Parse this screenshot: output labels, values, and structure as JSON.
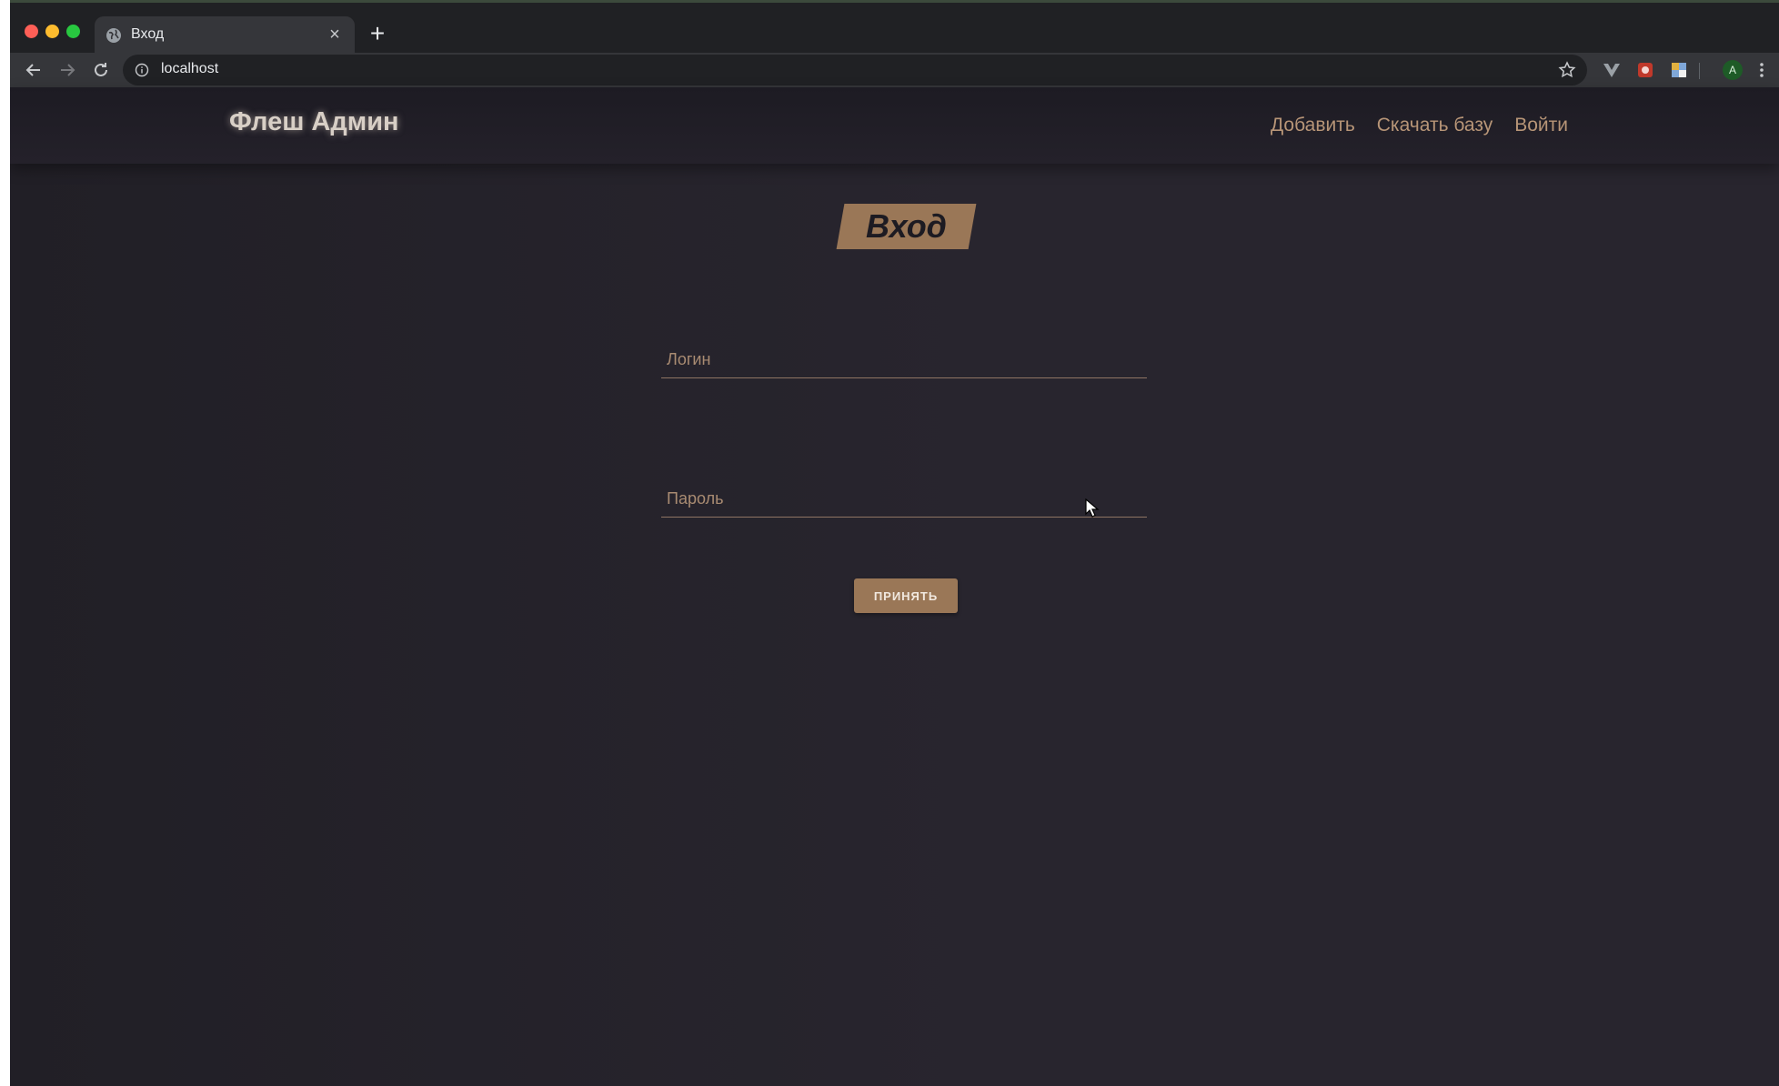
{
  "browser": {
    "tab": {
      "title": "Вход",
      "close_glyph": "×"
    },
    "new_tab_glyph": "+",
    "address_bar": {
      "url": "localhost"
    },
    "profile_initial": "A",
    "icons": [
      "back-icon",
      "forward-icon",
      "reload-icon",
      "info-icon",
      "star-icon",
      "vue-devtools-icon",
      "extension-icon",
      "extension-grid-icon",
      "kebab-menu-icon",
      "globe-icon"
    ]
  },
  "navbar": {
    "brand": "Флеш Админ",
    "links": [
      {
        "label": "Добавить"
      },
      {
        "label": "Скачать базу"
      },
      {
        "label": "Войти"
      }
    ]
  },
  "login": {
    "title": "Вход",
    "username": {
      "placeholder": "Логин",
      "value": ""
    },
    "password": {
      "placeholder": "Пароль",
      "value": ""
    },
    "submit_label": "ПРИНЯТЬ"
  },
  "colors": {
    "page_bg": "#28252e",
    "navbar_bg": "#1d1b23",
    "accent": "#9a7757",
    "link": "#b79577",
    "brand_text": "#d8cfc6"
  }
}
